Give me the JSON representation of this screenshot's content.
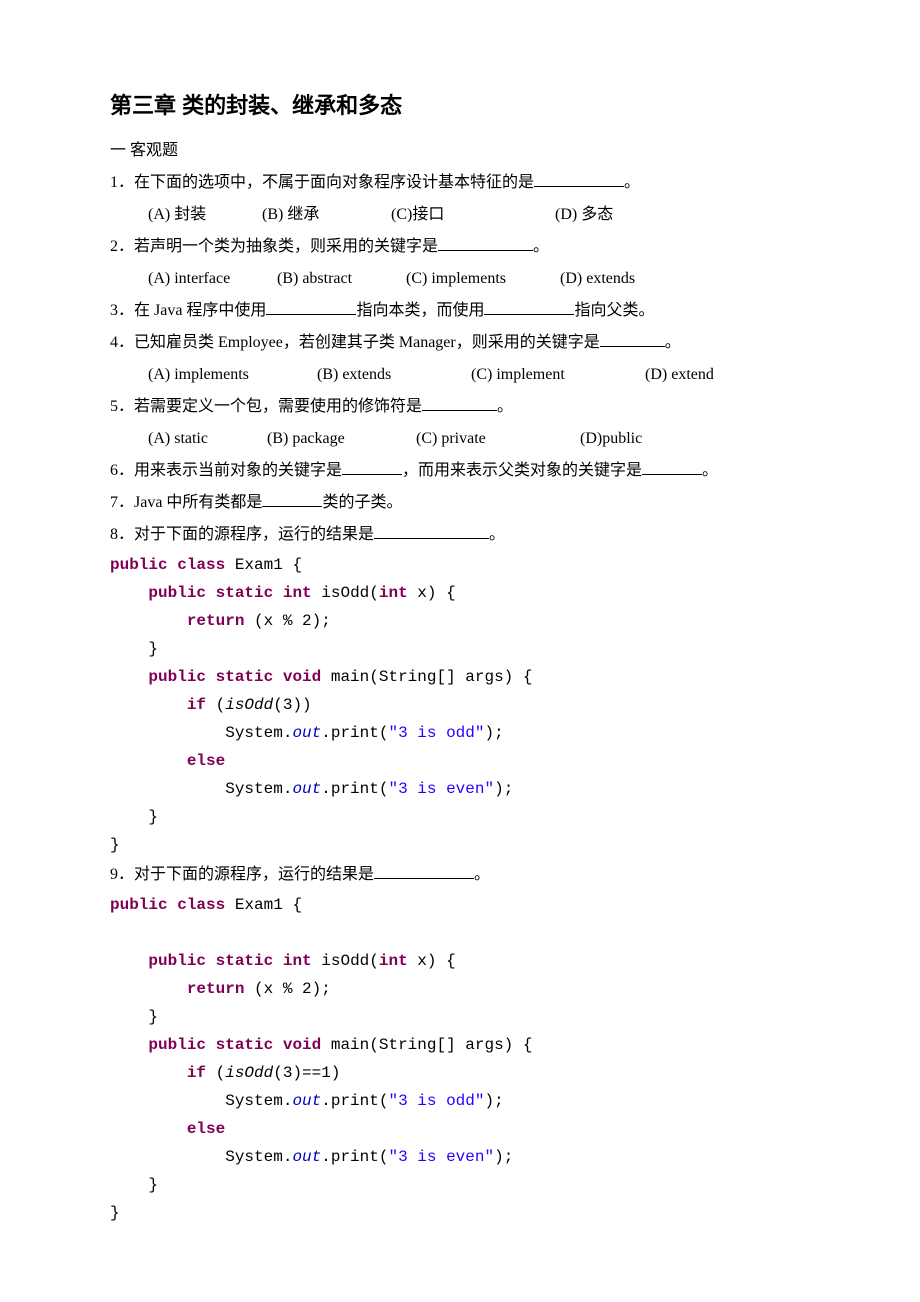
{
  "title": "第三章 类的封装、继承和多态",
  "section": "一 客观题",
  "q1": {
    "text_pre": "1．在下面的选项中，不属于面向对象程序设计基本特征的是",
    "text_post": "。",
    "optA": "(A) 封装",
    "optB": "(B) 继承",
    "optC": "(C)接口",
    "optD": "(D) 多态"
  },
  "q2": {
    "text_pre": "2．若声明一个类为抽象类，则采用的关键字是",
    "text_post": "。",
    "optA": "(A) interface",
    "optB": "(B) abstract",
    "optC": "(C) implements",
    "optD": "(D) extends"
  },
  "q3": {
    "part1": "3．在 Java 程序中使用",
    "part2": "指向本类，而使用",
    "part3": "指向父类。"
  },
  "q4": {
    "text_pre": "4．已知雇员类 Employee，若创建其子类 Manager，则采用的关键字是",
    "text_post": "。",
    "optA": "(A) implements",
    "optB": "(B) extends",
    "optC": "(C) implement",
    "optD": "(D) extend"
  },
  "q5": {
    "text_pre": "5．若需要定义一个包，需要使用的修饰符是",
    "text_post": "。",
    "optA": "(A) static",
    "optB": "(B) package",
    "optC": "(C) private",
    "optD": "(D)public"
  },
  "q6": {
    "part1": "6．用来表示当前对象的关键字是",
    "part2": "，而用来表示父类对象的关键字是",
    "part3": "。"
  },
  "q7": {
    "part1": "7．Java 中所有类都是",
    "part2": "类的子类。"
  },
  "q8": {
    "text_pre": "8．对于下面的源程序，运行的结果是",
    "text_post": "。"
  },
  "q9": {
    "text_pre": "9．对于下面的源程序，运行的结果是",
    "text_post": "。"
  },
  "code": {
    "kw_public": "public",
    "kw_class": "class",
    "kw_static": "static",
    "kw_int": "int",
    "kw_void": "void",
    "kw_return": "return",
    "kw_if": "if",
    "kw_else": "else",
    "cls_exam1": " Exam1 {",
    "fn_isodd_sig": " isOdd(",
    "param_x": " x) {",
    "return_expr": " (x % 2);",
    "close_brace": "    }",
    "close_brace_root": "}",
    "fn_main_sig": " main(String[] args) {",
    "if_cond_1": " (",
    "isodd_call": "isOdd",
    "if_cond_1_arg": "(3))",
    "if_cond_2_arg": "(3)==1)",
    "sys": "            System.",
    "out": "out",
    "print_odd_pre": ".print(",
    "str_odd": "\"3 is odd\"",
    "str_even": "\"3 is even\"",
    "print_close": ");"
  }
}
